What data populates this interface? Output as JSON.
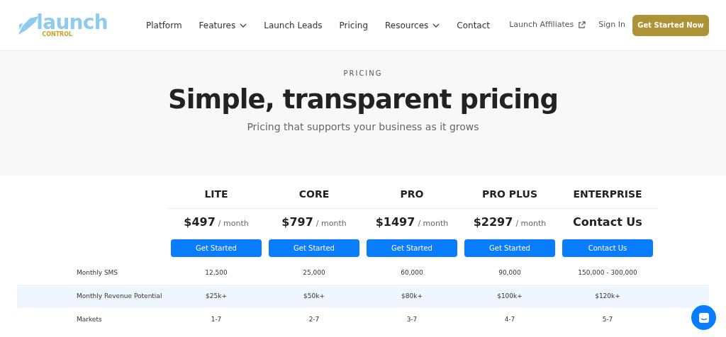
{
  "logo": {
    "word": "launch",
    "subword": "CONTROL"
  },
  "nav": [
    {
      "label": "Platform",
      "dropdown": false
    },
    {
      "label": "Features",
      "dropdown": true
    },
    {
      "label": "Launch Leads",
      "dropdown": false
    },
    {
      "label": "Pricing",
      "dropdown": false
    },
    {
      "label": "Resources",
      "dropdown": true
    },
    {
      "label": "Contact",
      "dropdown": false
    }
  ],
  "header_actions": {
    "affiliates": "Launch Affiliates",
    "sign_in": "Sign In",
    "cta": "Get Started Now"
  },
  "hero": {
    "eyebrow": "PRICING",
    "title": "Simple, transparent pricing",
    "subtitle": "Pricing that supports your business as it grows"
  },
  "plans": [
    {
      "name": "LITE",
      "kind": "priced",
      "price": "$497",
      "period": "/ month",
      "button": "Get Started"
    },
    {
      "name": "CORE",
      "kind": "priced",
      "price": "$797",
      "period": "/ month",
      "button": "Get Started"
    },
    {
      "name": "PRO",
      "kind": "priced",
      "price": "$1497",
      "period": "/ month",
      "button": "Get Started"
    },
    {
      "name": "PRO PLUS",
      "kind": "priced",
      "price": "$2297",
      "period": "/ month",
      "button": "Get Started"
    },
    {
      "name": "ENTERPRISE",
      "kind": "contact",
      "price": "Contact Us",
      "button": "Contact Us"
    }
  ],
  "rows": [
    {
      "label": "Monthly SMS",
      "shaded": false,
      "values": [
        "12,500",
        "25,000",
        "60,000",
        "90,000",
        "150,000 - 300,000"
      ]
    },
    {
      "label": "Monthly Revenue Potential",
      "shaded": true,
      "values": [
        "$25k+",
        "$50k+",
        "$80k+",
        "$100k+",
        "$120k+"
      ]
    },
    {
      "label": "Markets",
      "shaded": false,
      "values": [
        "1-7",
        "2-7",
        "3-7",
        "4-7",
        "5-7"
      ]
    }
  ]
}
